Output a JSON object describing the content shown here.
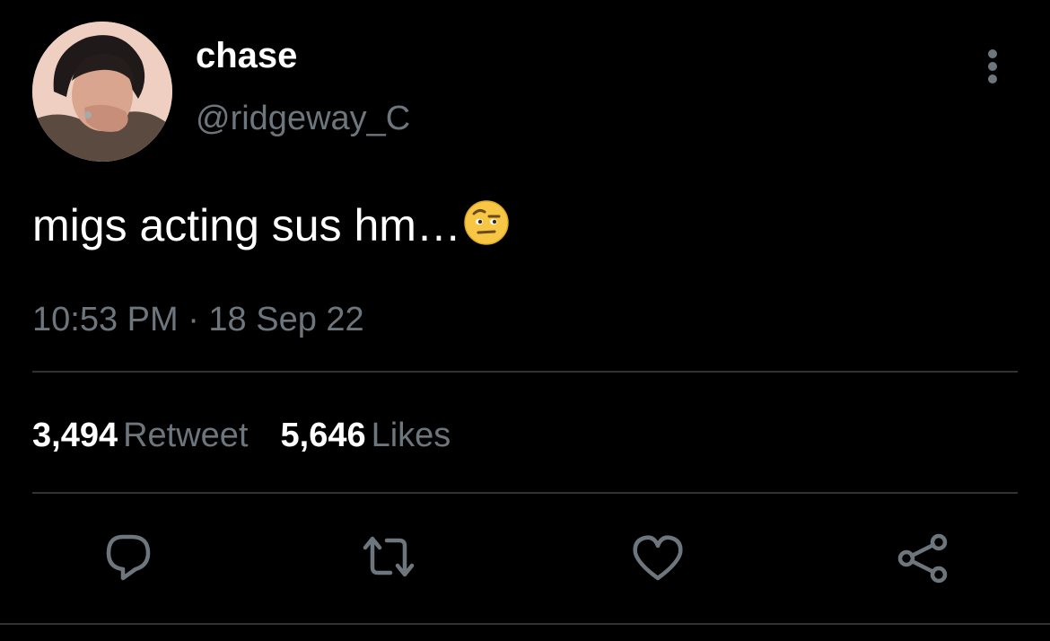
{
  "user": {
    "display_name": "chase",
    "handle": "@ridgeway_C",
    "avatar_icon": "profile-photo"
  },
  "tweet": {
    "text": "migs acting sus hm…",
    "emoji": "face-with-raised-eyebrow",
    "timestamp": "10:53 PM · 18 Sep 22"
  },
  "stats": {
    "retweets_count": "3,494",
    "retweets_label": "Retweet",
    "likes_count": "5,646",
    "likes_label": "Likes"
  },
  "actions": {
    "more_icon": "more-vertical-icon",
    "reply_icon": "reply-icon",
    "retweet_icon": "retweet-icon",
    "like_icon": "heart-icon",
    "share_icon": "share-icon"
  },
  "colors": {
    "background": "#000000",
    "primary_text": "#ffffff",
    "secondary_text": "#6e767d",
    "divider": "#2f3336"
  }
}
